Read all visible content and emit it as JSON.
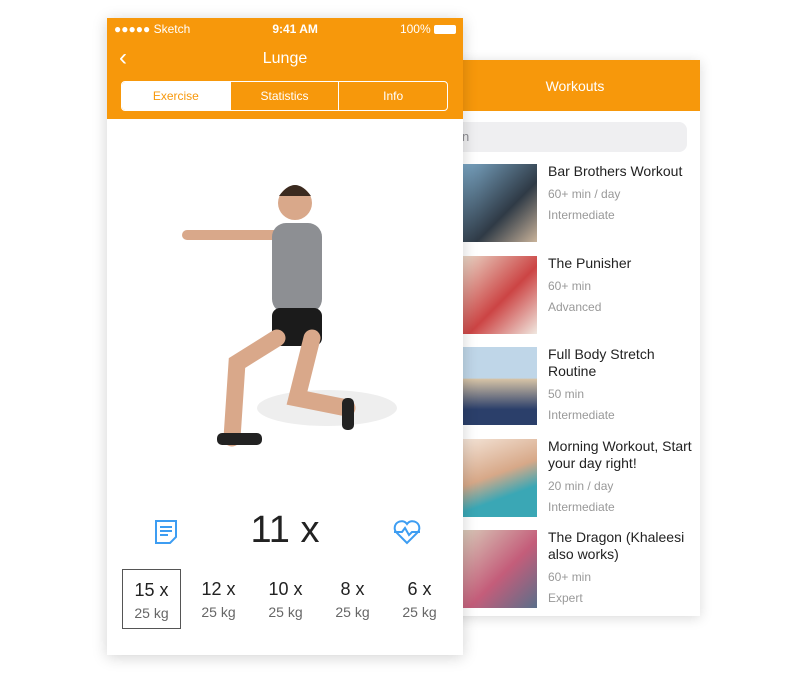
{
  "status_bar": {
    "carrier": "●●●●● Sketch",
    "time": "9:41 AM",
    "battery": "100%"
  },
  "exercise": {
    "title": "Lunge",
    "tabs": [
      "Exercise",
      "Statistics",
      "Info"
    ],
    "active_tab": "Exercise",
    "reps": "11 x",
    "sets": [
      {
        "reps": "15 x",
        "weight": "25 kg",
        "selected": true
      },
      {
        "reps": "12 x",
        "weight": "25 kg"
      },
      {
        "reps": "10 x",
        "weight": "25 kg"
      },
      {
        "reps": "8 x",
        "weight": "25 kg"
      },
      {
        "reps": "6 x",
        "weight": "25 kg"
      }
    ],
    "icons": [
      "back-chevron-icon",
      "notes-icon",
      "heart-rate-icon"
    ]
  },
  "workouts": {
    "title": "Workouts",
    "search_placeholder": "n",
    "items": [
      {
        "title": "Bar Brothers Workout",
        "duration": "60+ min / day",
        "level": "Intermediate"
      },
      {
        "title": "The Punisher",
        "duration": "60+ min",
        "level": "Advanced"
      },
      {
        "title": "Full Body Stretch Routine",
        "duration": "50 min",
        "level": "Intermediate"
      },
      {
        "title": "Morning Workout, Start your day right!",
        "duration": "20 min / day",
        "level": "Intermediate"
      },
      {
        "title": "The Dragon (Khaleesi also works)",
        "duration": "60+ min",
        "level": "Expert"
      }
    ]
  },
  "colors": {
    "accent": "#f7980b",
    "icon_blue": "#3d9df2"
  }
}
